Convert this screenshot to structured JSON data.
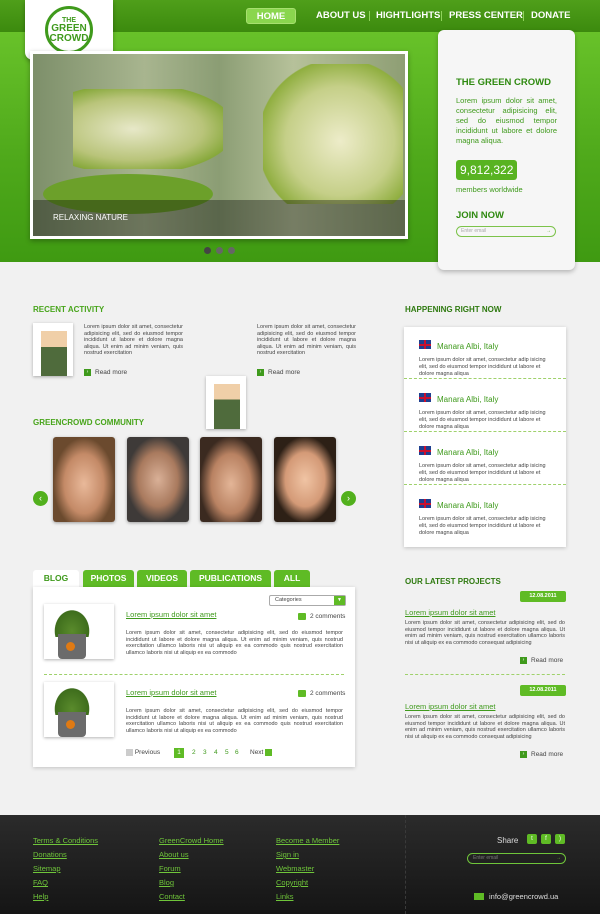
{
  "logo": {
    "line1": "THE",
    "line2": "GREEN",
    "line3": "CROWD"
  },
  "nav": {
    "home": "HOME",
    "about": "ABOUT US",
    "highlights": "HIGHTLIGHTS",
    "press": "PRESS CENTER",
    "donate": "DONATE"
  },
  "slider": {
    "caption": "RELAXING NATURE",
    "dots": 3,
    "active_dot": 1
  },
  "panel": {
    "title": "THE GREEN CROWD",
    "text": "Lorem ipsum dolor sit amet, consectetur adipisicing elit, sed do eiusmod tempor incididunt ut labore et dolore magna aliqua.",
    "members_count": "9,812,322",
    "members_label": "members worldwide",
    "join_title": "JOIN NOW",
    "email_placeholder": "Enter email"
  },
  "recent": {
    "title": "RECENT ACTIVITY",
    "items": [
      {
        "text": "Lorem ipsum dolor sit amet, consectetur adipisicing elit, sed do eiusmod tempor incididunt ut labore et dolore magna aliqua. Ut enim ad minim veniam, quis nostrud exercitation",
        "more": "Read more"
      },
      {
        "text": "Lorem ipsum dolor sit amet, consectetur adipisicing elit, sed do eiusmod tempor incididunt ut labore et dolore magna aliqua. Ut enim ad minim veniam, quis nostrud exercitation",
        "more": "Read more"
      }
    ]
  },
  "community": {
    "title": "GREENCROWD COMMUNITY"
  },
  "happening": {
    "title": "HAPPENING RIGHT NOW",
    "items": [
      {
        "location": "Manara Albi, Italy",
        "text": "Lorem ipsum dolor sit amet, consectetur adip isicing elit, sed do eiusmod tempor incididunt ut labore et dolore magna aliqua"
      },
      {
        "location": "Manara Albi, Italy",
        "text": "Lorem ipsum dolor sit amet, consectetur adip isicing elit, sed do eiusmod tempor incididunt ut labore et dolore magna aliqua"
      },
      {
        "location": "Manara Albi, Italy",
        "text": "Lorem ipsum dolor sit amet, consectetur adip isicing elit, sed do eiusmod tempor incididunt ut labore et dolore magna aliqua"
      },
      {
        "location": "Manara Albi, Italy",
        "text": "Lorem ipsum dolor sit amet, consectetur adip isicing elit, sed do eiusmod tempor incididunt ut labore et dolore magna aliqua"
      }
    ]
  },
  "blog": {
    "tabs": [
      "BLOG",
      "PHOTOS",
      "VIDEOS",
      "PUBLICATIONS",
      "ALL"
    ],
    "categories": "Categories",
    "posts": [
      {
        "title": "Lorem ipsum dolor sit amet",
        "comments": "2 comments",
        "text": "Lorem ipsum dolor sit amet, consectetur adipisicing elit, sed do eiusmod tempor incididunt ut labore et dolore magna aliqua. Ut enim ad minim veniam, quis nostrud exercitation ullamco laboris nisi ut aliquip ex ea commodo quis nostrud exercitation ullamco laboris nisi ut aliquip ex ea commodo"
      },
      {
        "title": "Lorem ipsum dolor sit amet",
        "comments": "2 comments",
        "text": "Lorem ipsum dolor sit amet, consectetur adipisicing elit, sed do eiusmod tempor incididunt ut labore et dolore magna aliqua. Ut enim ad minim veniam, quis nostrud exercitation ullamco laboris nisi ut aliquip ex ea commodo quis nostrud exercitation ullamco laboris nisi ut aliquip ex ea commodo"
      }
    ],
    "pagination": {
      "prev": "Previous",
      "pages": [
        "1",
        "2",
        "3",
        "4",
        "5",
        "6"
      ],
      "current": "1",
      "next": "Next"
    }
  },
  "projects": {
    "title": "OUR LATEST PROJECTS",
    "items": [
      {
        "date": "12.08.2011",
        "title": "Lorem ipsum dolor sit amet",
        "text": "Lorem ipsum dolor sit amet, consectetur adipisicing elit, sed do eiusmod tempor incididunt ut labore et dolore magna aliqua. Ut enim ad minim veniam, quis nostrud exercitation ullamco laboris nisi ut aliquip ex ea commodo consequat adipisicing",
        "more": "Read more"
      },
      {
        "date": "12.08.2011",
        "title": "Lorem ipsum dolor sit amet",
        "text": "Lorem ipsum dolor sit amet, consectetur adipisicing elit, sed do eiusmod tempor incididunt ut labore et dolore magna aliqua. Ut enim ad minim veniam, quis nostrud exercitation ullamco laboris nisi ut aliquip ex ea commodo consequat adipisicing",
        "more": "Read more"
      }
    ]
  },
  "footer": {
    "col1": [
      "Terms & Conditions",
      "Donations",
      "Sitemap",
      "FAQ",
      "Help"
    ],
    "col2": [
      "GreenCrowd Home",
      "About us",
      "Forum",
      "Blog",
      "Contact"
    ],
    "col3": [
      "Become a Member",
      "Sign in",
      "Webmaster",
      "Copyright",
      "Links"
    ],
    "share": "Share",
    "email_placeholder": "Enter email",
    "contact_email": "info@greencrowd.ua"
  },
  "colors": {
    "brand_green": "#4fa91b",
    "dark_green": "#2f8a10",
    "footer_bg": "#1f1f1f"
  }
}
